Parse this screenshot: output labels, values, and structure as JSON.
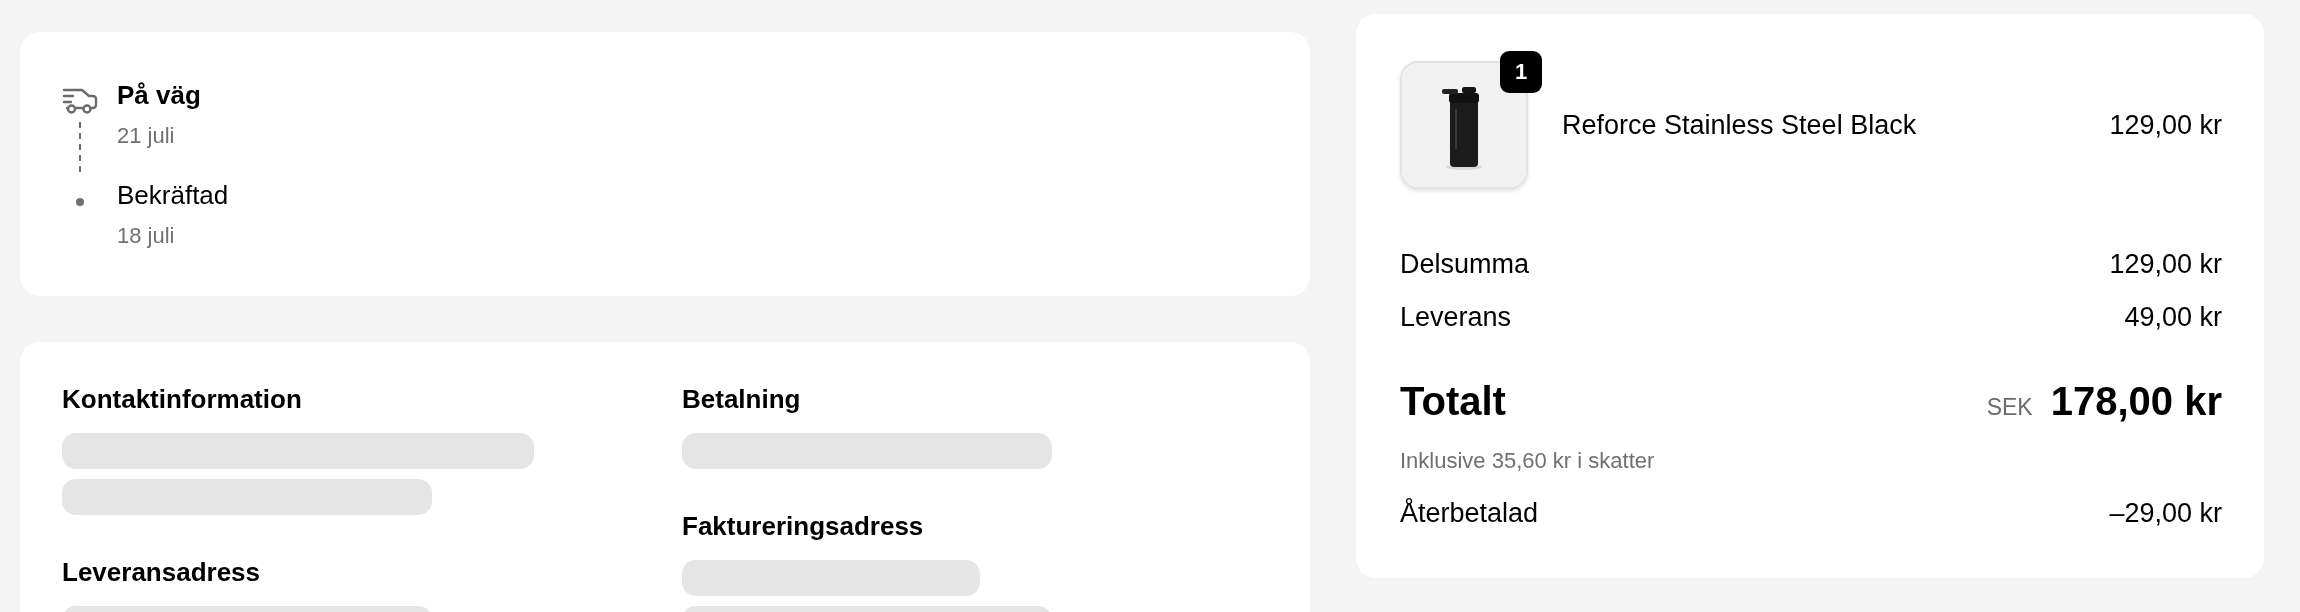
{
  "tracking": {
    "steps": [
      {
        "kind": "truck",
        "title": "På väg",
        "date": "21 juli",
        "current": true
      },
      {
        "kind": "dot",
        "title": "Bekräftad",
        "date": "18 juli",
        "current": false
      }
    ]
  },
  "details": {
    "loading": true,
    "columns": [
      [
        {
          "heading": "Kontaktinformation",
          "placeholders": [
            {
              "kind": "skeleton"
            },
            {
              "kind": "skeleton"
            }
          ]
        },
        {
          "heading": "Leveransadress",
          "placeholders": [
            {
              "kind": "skeleton"
            }
          ]
        }
      ],
      [
        {
          "heading": "Betalning",
          "placeholders": [
            {
              "kind": "skeleton"
            }
          ]
        },
        {
          "heading": "Faktureringsadress",
          "placeholders": [
            {
              "kind": "skeleton"
            },
            {
              "kind": "skeleton"
            }
          ]
        }
      ]
    ]
  },
  "summary": {
    "item": {
      "kind": "picture",
      "quantity": "1",
      "name": "Reforce Stainless Steel Black",
      "price": "129,00 kr"
    },
    "lines": [
      {
        "label": "Delsumma",
        "value": "129,00 kr"
      },
      {
        "label": "Leverans",
        "value": "49,00 kr"
      }
    ],
    "total": {
      "label": "Totalt",
      "currency": "SEK",
      "value": "178,00 kr"
    },
    "tax_note": "Inklusive 35,60 kr i skatter",
    "refund": {
      "label": "Återbetalad",
      "value": "–29,00 kr"
    }
  }
}
